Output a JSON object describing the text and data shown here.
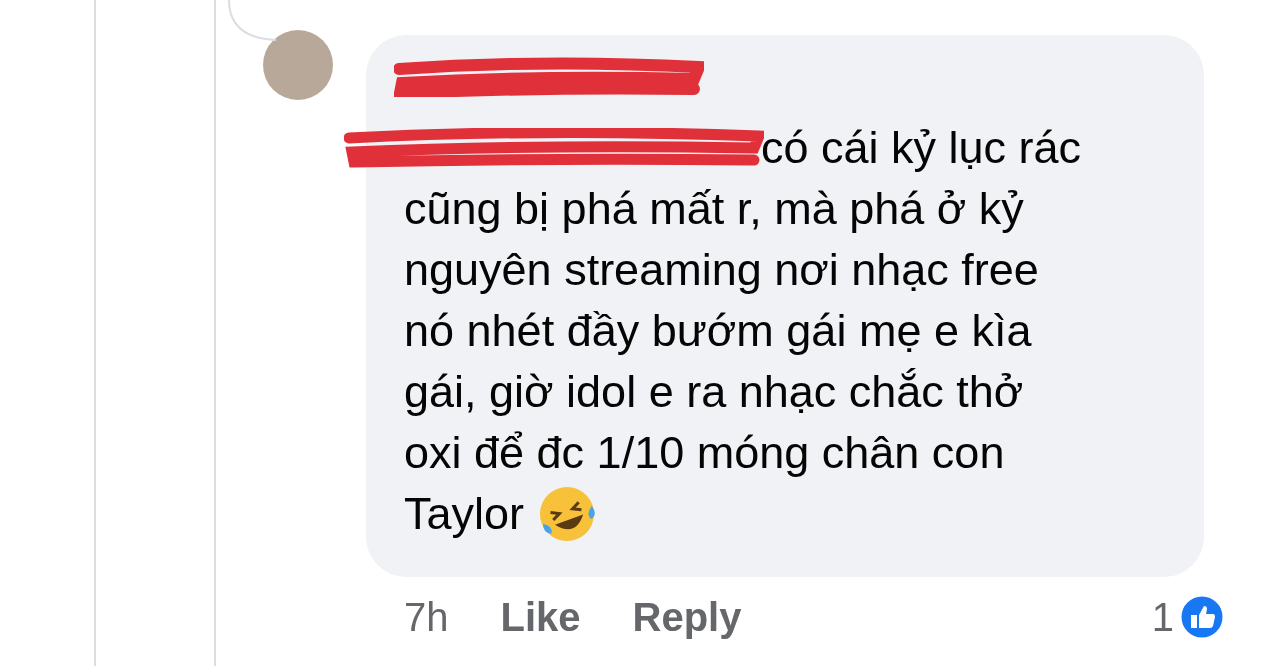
{
  "comment": {
    "lines": [
      "có cái kỷ lục rác",
      "cũng bị phá mất r, mà phá ở kỷ",
      "nguyên streaming nơi nhạc free",
      "nó nhét đầy bướm gái mẹ e kìa",
      "gái, giờ idol e ra nhạc chắc thở",
      "oxi để đc 1/10 móng chân con",
      "Taylor"
    ],
    "time": "7h",
    "actions": [
      "Like",
      "Reply"
    ],
    "reaction_count": "1"
  }
}
